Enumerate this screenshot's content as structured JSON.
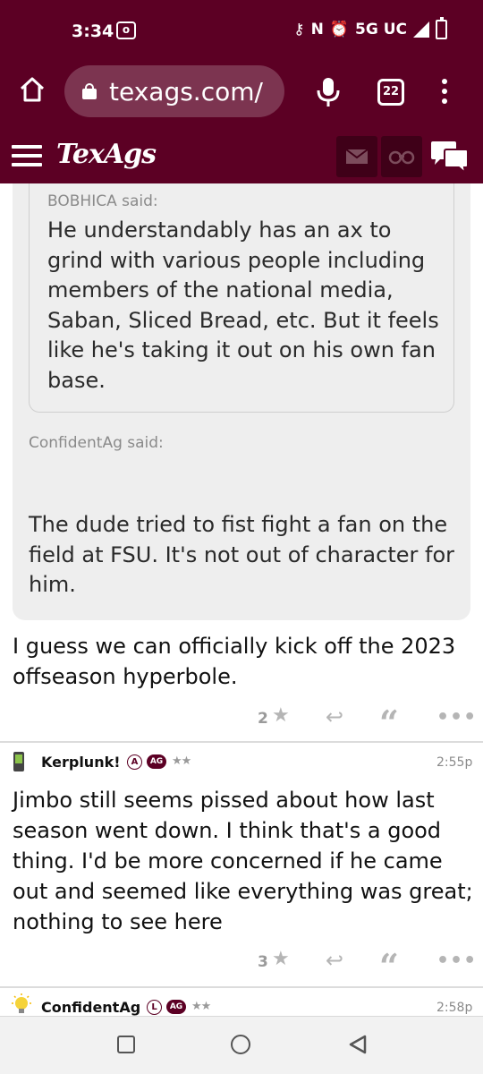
{
  "status_bar": {
    "time": "3:34",
    "network": "5G UC",
    "cast_label": "(o)"
  },
  "browser": {
    "url": "texags.com/",
    "tab_count": "22",
    "icons": [
      "home-icon",
      "lock-icon",
      "mic-icon",
      "tabs-icon",
      "kebab-menu-icon"
    ]
  },
  "site_nav": {
    "logo": "TexAgs",
    "icons": [
      "hamburger-icon",
      "mail-icon",
      "binoculars-icon",
      "chat-icon"
    ]
  },
  "quote": {
    "inner_author": "BOBHICA said:",
    "inner_text": "He understandably has an ax to grind with various people including members of the national media, Saban, Sliced Bread, etc. But it feels like he's taking it out on his own fan base.",
    "outer_author": "ConfidentAg said:",
    "outer_text": "The dude tried to fist fight a fan on the field at FSU. It's not out of character for him."
  },
  "posts": [
    {
      "body": "I guess we can officially kick off the 2023 offseason hyperbole.",
      "likes": "2"
    },
    {
      "author": "Kerplunk!",
      "badge_letter": "A",
      "badge_ag": "AG",
      "stars": "★★",
      "time": "2:55p",
      "body": "Jimbo still seems pissed about how last season went down. I think that's a good thing. I'd be more concerned if he came out and seemed like everything was great; nothing to see here",
      "likes": "3"
    },
    {
      "author": "ConfidentAg",
      "badge_letter": "L",
      "badge_ag": "AG",
      "stars": "★★",
      "time": "2:58p"
    }
  ],
  "colors": {
    "brand": "#5c0024",
    "quote_bg": "#eeeeee"
  }
}
